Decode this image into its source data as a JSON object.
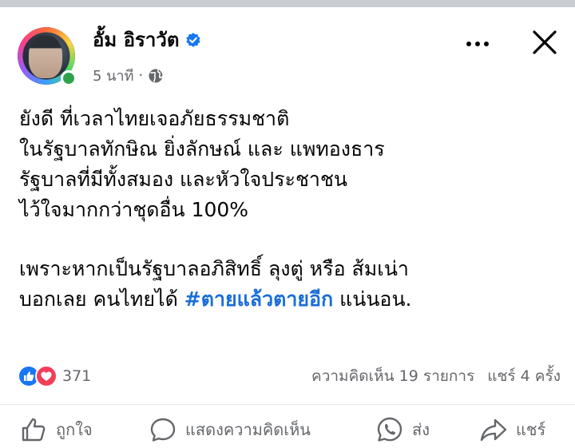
{
  "post": {
    "author_name": "อั้ม อิราวัต",
    "time": "5 นาที",
    "separator": "·",
    "body_lines": [
      "ยังดี ที่เวลาไทยเจอภัยธรรมชาติ",
      "ในรัฐบาลทักษิณ ยิ่งลักษณ์ และ แพทองธาร",
      "รัฐบาลที่มีทั้งสมอง และหัวใจประชาชน",
      "ไว้ใจมากกว่าชุดอื่น 100%"
    ],
    "body_line_5": "เพราะหากเป็นรัฐบาลอภิสิทธิ์ ลุงตู่ หรือ ส้มเน่า",
    "body_line_6_prefix": "บอกเลย คนไทยได้ ",
    "hashtag": "#ตายแล้วตายอีก",
    "body_line_6_suffix": " แน่นอน."
  },
  "stats": {
    "reaction_count": "371",
    "comments": "ความคิดเห็น 19 รายการ",
    "shares": "แชร์ 4 ครั้ง"
  },
  "actions": {
    "like": "ถูกใจ",
    "comment": "แสดงความคิดเห็น",
    "send": "ส่ง",
    "share": "แชร์"
  },
  "icons": {
    "verified": "verified-badge-icon",
    "privacy": "globe-icon",
    "more": "more-options-icon",
    "close": "close-icon",
    "like_reaction": "thumbs-up-reaction-icon",
    "love_reaction": "heart-reaction-icon",
    "like_action": "thumbs-up-icon",
    "comment_action": "comment-bubble-icon",
    "send_action": "whatsapp-icon",
    "share_action": "share-arrow-icon"
  },
  "colors": {
    "hashtag": "#1a6ed8",
    "like_blue": "#1877f2",
    "love_red": "#f33e58",
    "online_green": "#31a24c",
    "muted_text": "#65676b"
  }
}
